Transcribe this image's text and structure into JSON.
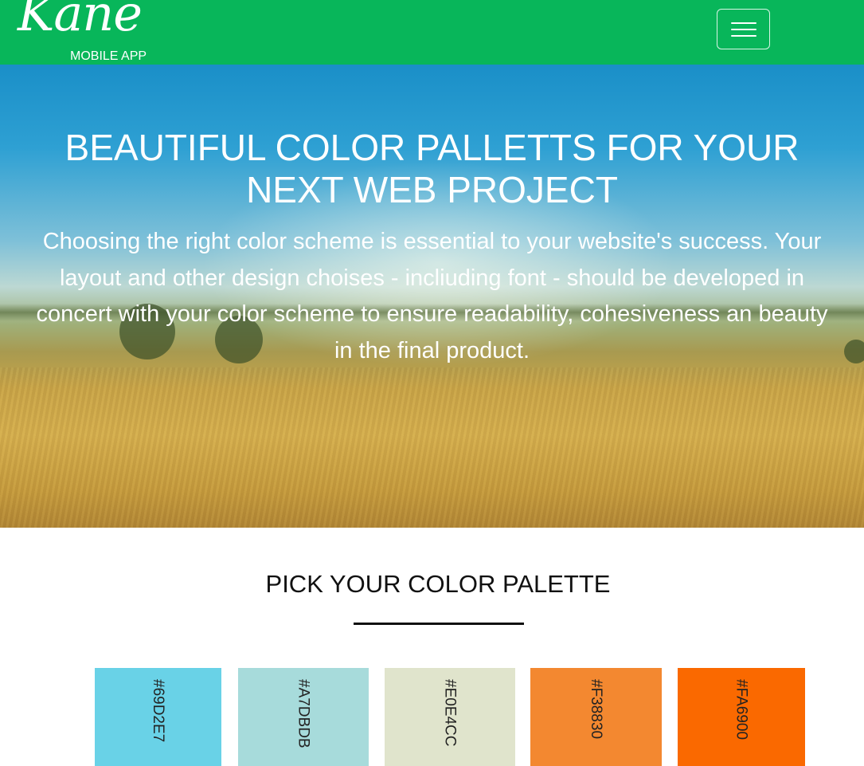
{
  "header": {
    "brand_script": "Kane",
    "brand_sub": "MOBILE APP",
    "background": "#08b65a",
    "menu_icon": "hamburger-menu-icon"
  },
  "hero": {
    "title": "BEAUTIFUL COLOR PALLETTS FOR YOUR NEXT WEB PROJECT",
    "text": "Choosing the right color scheme is essential to your website's success. Your layout and other design choises - incliuding font - should be developed in concert with your color scheme to ensure readability, cohesiveness an beauty in the final product."
  },
  "palette": {
    "title": "PICK YOUR COLOR PALETTE",
    "swatches": [
      {
        "label": "#69D2E7",
        "color": "#69D2E7"
      },
      {
        "label": "#A7DBDB",
        "color": "#A7DBDB"
      },
      {
        "label": "#E0E4CC",
        "color": "#E0E4CC"
      },
      {
        "label": "#F38830",
        "color": "#F38830"
      },
      {
        "label": "#FA6900",
        "color": "#FA6900"
      }
    ]
  }
}
